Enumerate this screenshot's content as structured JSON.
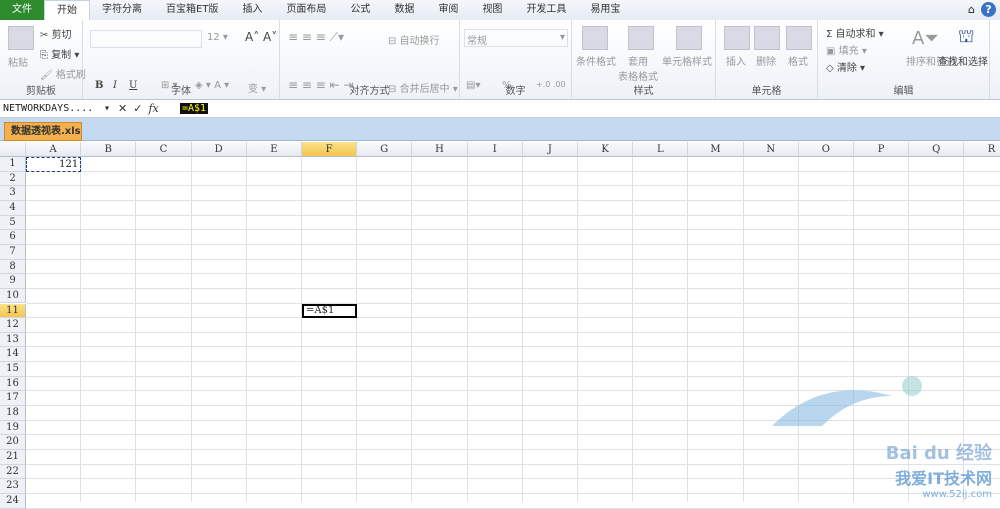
{
  "tabs": [
    "文件",
    "开始",
    "字符分离",
    "百宝箱ET版",
    "插入",
    "页面布局",
    "公式",
    "数据",
    "审阅",
    "视图",
    "开发工具",
    "易用宝"
  ],
  "help_icon": "?",
  "ribbon": {
    "clipboard": {
      "paste": "粘贴",
      "cut": "剪切",
      "copy": "复制",
      "format_painter": "格式刷",
      "label": "剪贴板"
    },
    "font": {
      "size": "12",
      "bold": "B",
      "italic": "I",
      "underline": "U",
      "label": "字体"
    },
    "alignment": {
      "wrap": "自动换行",
      "merge": "合并后居中",
      "label": "对齐方式"
    },
    "number": {
      "format": "常规",
      "percent": "%",
      "comma": ",",
      "label": "数字"
    },
    "styles": {
      "conditional": "条件格式",
      "table_format": "套用\n表格格式",
      "cell_styles": "单元格样式",
      "label": "样式"
    },
    "cells": {
      "insert": "插入",
      "delete": "删除",
      "format": "格式",
      "label": "单元格"
    },
    "editing": {
      "autosum": "自动求和",
      "fill": "填充",
      "clear": "清除",
      "sort": "排序和筛选",
      "find": "查找和选择",
      "label": "编辑"
    }
  },
  "formula_bar": {
    "name_box": "NETWORKDAYS....",
    "cancel": "✕",
    "enter": "✓",
    "fx": "fx",
    "formula": "=A$1"
  },
  "workbook_tab": "数据透视表.xls",
  "columns": [
    "A",
    "B",
    "C",
    "D",
    "E",
    "F",
    "G",
    "H",
    "I",
    "J",
    "K",
    "L",
    "M",
    "N",
    "O",
    "P",
    "Q",
    "R"
  ],
  "rows": [
    1,
    2,
    3,
    4,
    5,
    6,
    7,
    8,
    9,
    10,
    11,
    12,
    13,
    14,
    15,
    16,
    17,
    18,
    19,
    20,
    21,
    22,
    23,
    24
  ],
  "cells": {
    "A1": "121",
    "F11": "=A$1"
  },
  "active_column": "F",
  "active_row": 11,
  "watermark": {
    "brand": "Bai du 经验",
    "site": "我爱IT技术网",
    "url": "www.52ij.com"
  }
}
